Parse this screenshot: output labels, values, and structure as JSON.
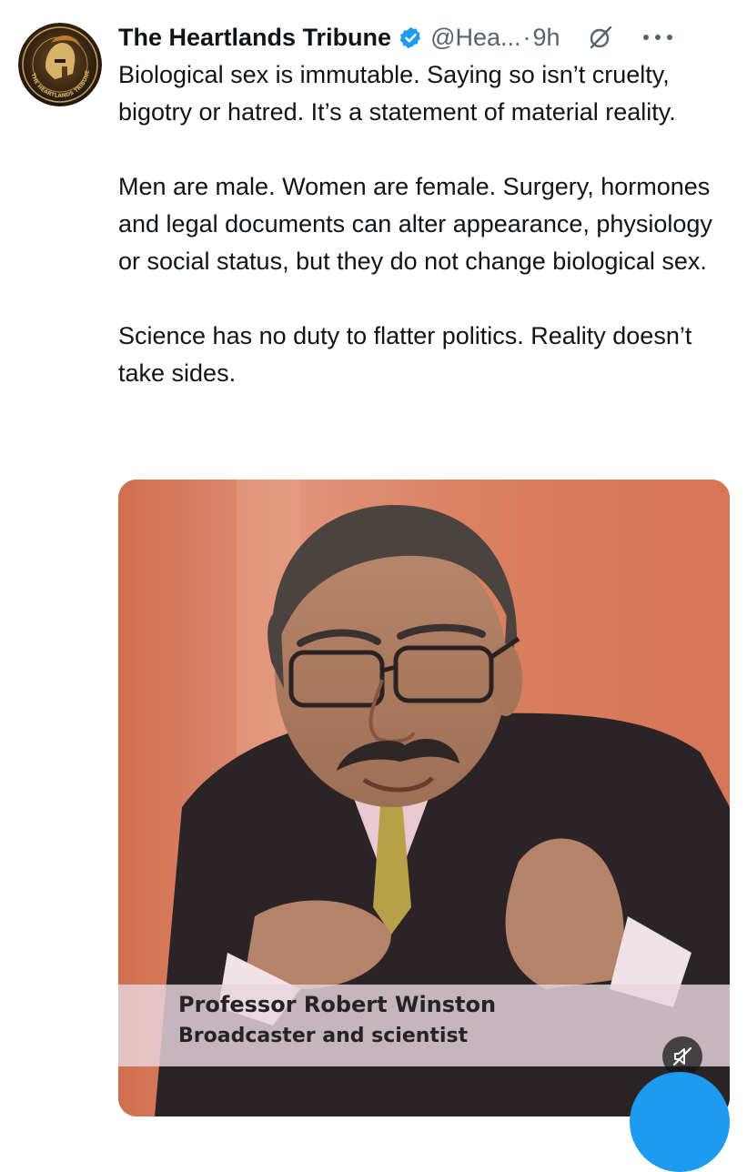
{
  "tweet": {
    "author_name": "The Heartlands Tribune",
    "handle": "@Hea...",
    "separator": "·",
    "timestamp": "9h",
    "avatar_text": "THE HEARTLANDS TRIBUNE",
    "paragraphs": [
      "Biological sex is immutable. Saying so isn’t cruelty, bigotry or hatred. It’s a statement of material reality.",
      "Men are male. Women are female. Surgery, hormones and legal documents can alter appearance, physiology or social status, but they do not change biological sex.",
      "Science has no duty to flatter politics. Reality doesn’t take sides."
    ]
  },
  "media": {
    "caption_name": "Professor Robert Winston",
    "caption_role": "Broadcaster and scientist",
    "muted": true
  },
  "icons": {
    "verified": "verified-badge-icon",
    "grok": "grok-icon",
    "more": "more-options-icon",
    "mute": "mute-icon"
  },
  "colors": {
    "verified": "#1d9bf0",
    "secondary_text": "#536471",
    "primary_text": "#0f1419",
    "compose_button": "#1d9bf0"
  }
}
